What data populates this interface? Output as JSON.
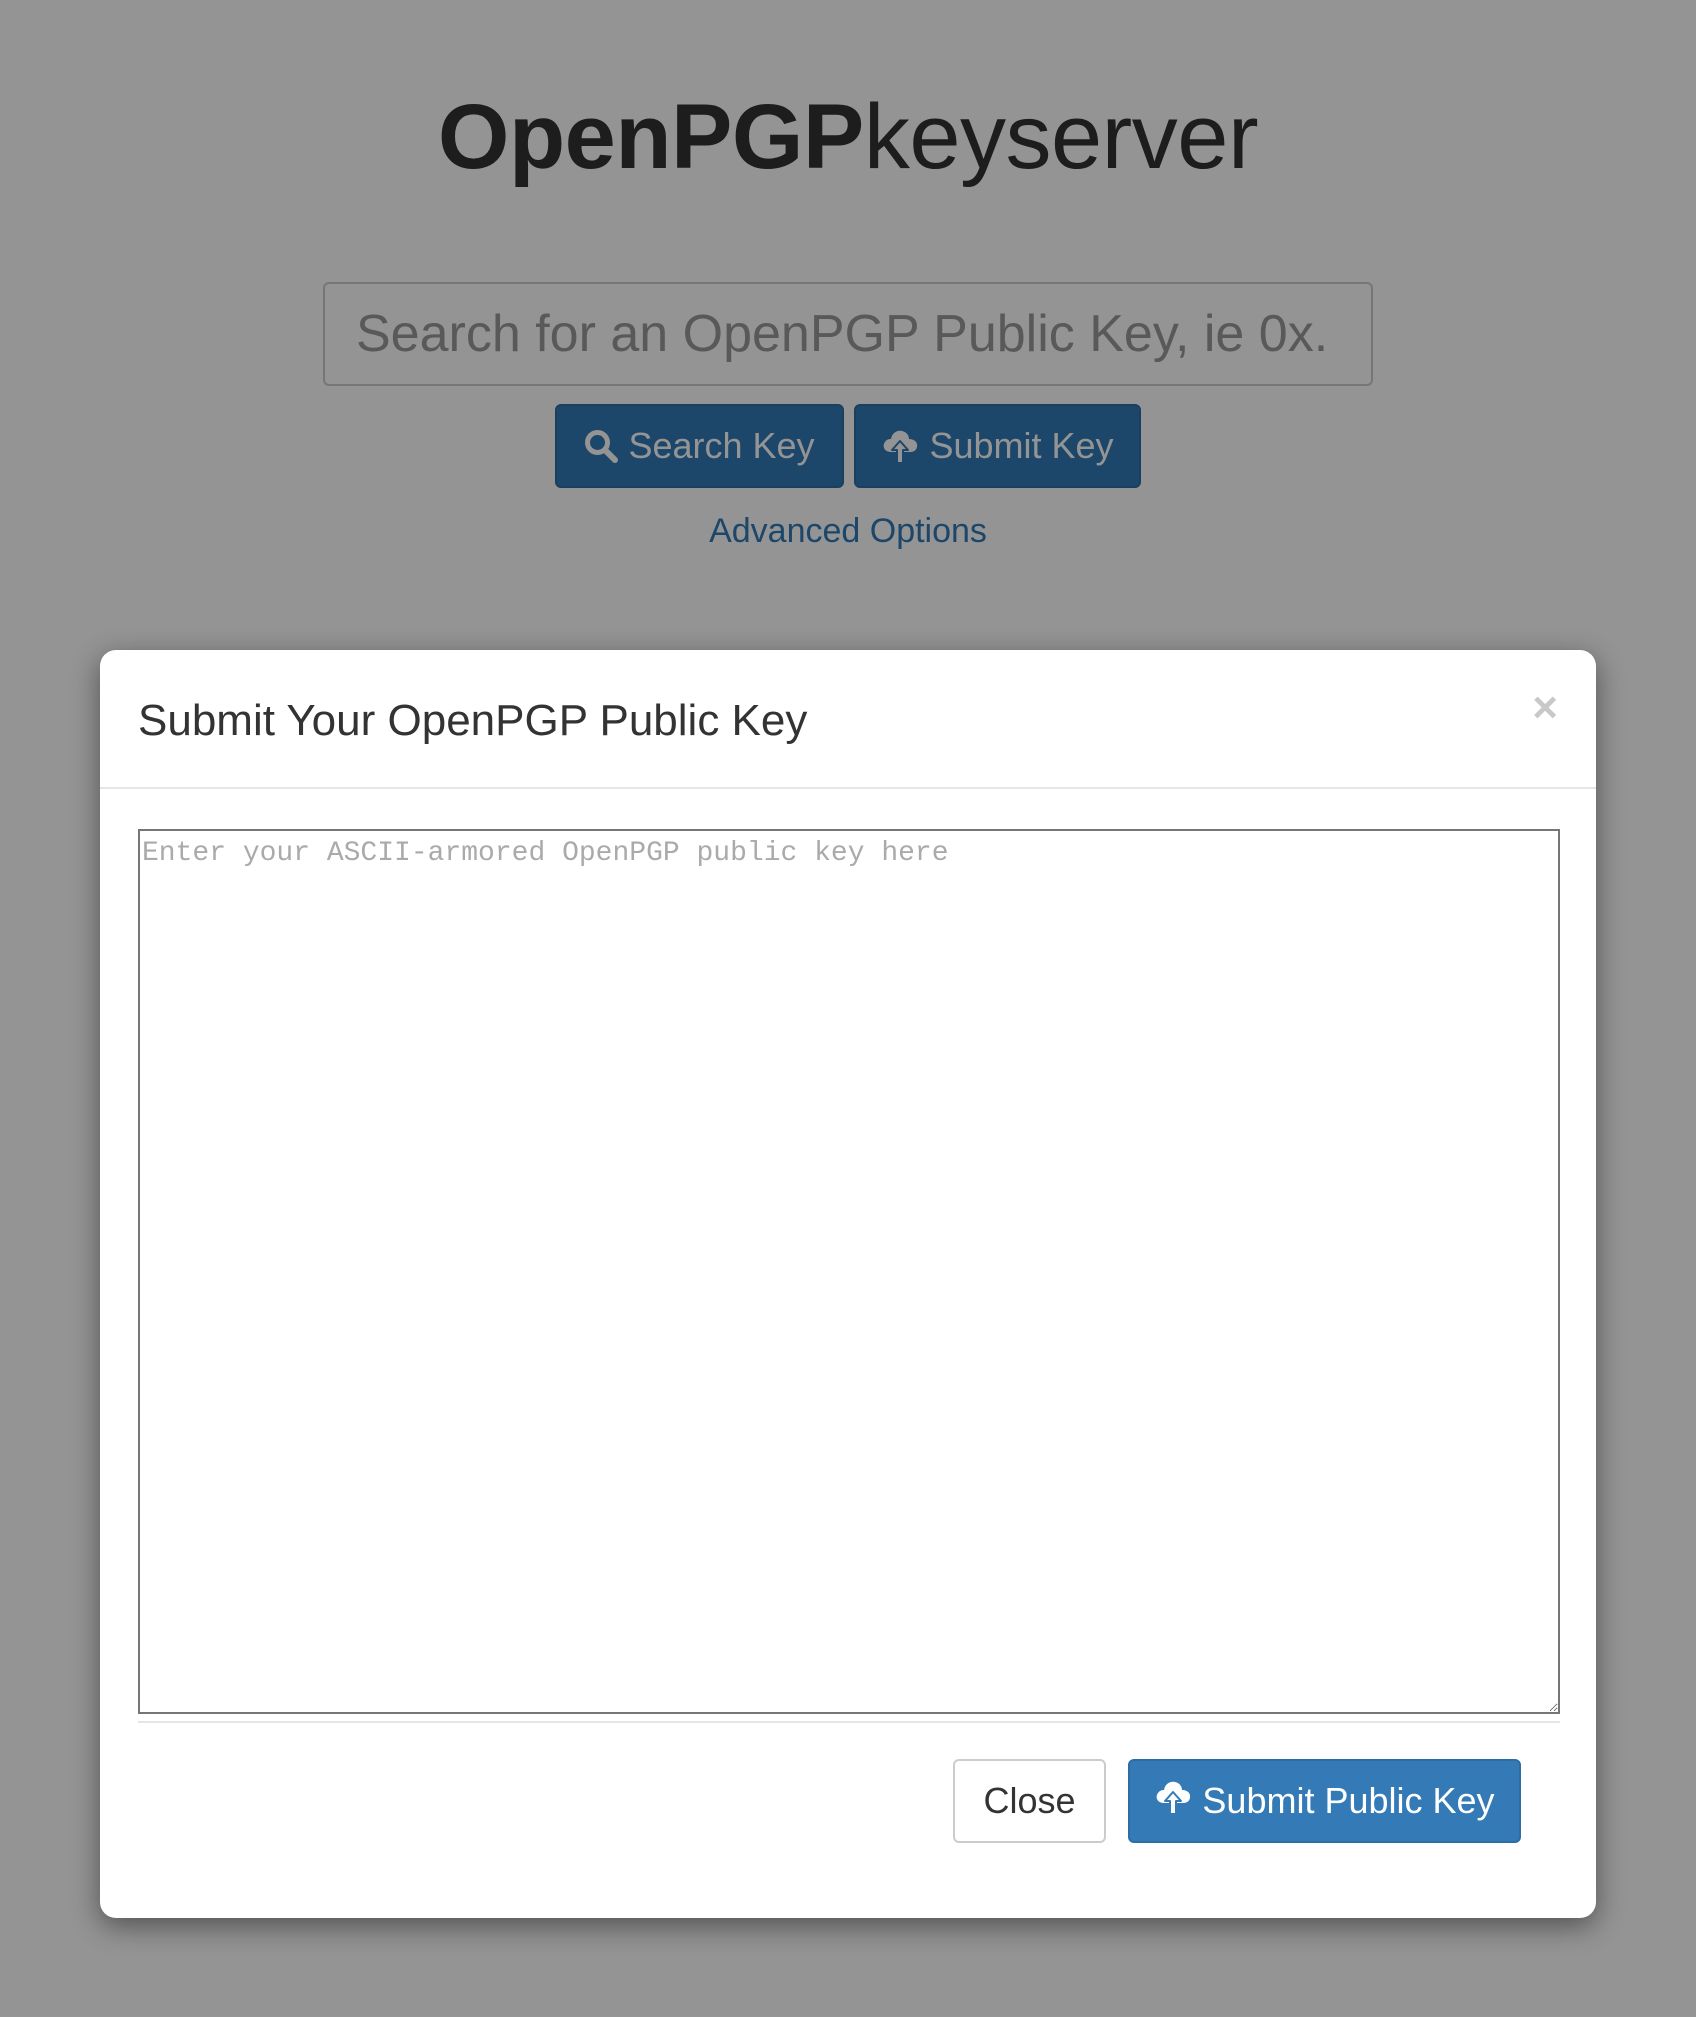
{
  "header": {
    "brand_bold": "OpenPGP",
    "brand_regular": "keyserver"
  },
  "search": {
    "placeholder": "Search for an OpenPGP Public Key, ie 0x.",
    "search_button_label": "Search Key",
    "submit_button_label": "Submit Key",
    "advanced_link": "Advanced Options"
  },
  "modal": {
    "title": "Submit Your OpenPGP Public Key",
    "close_glyph": "×",
    "textarea_placeholder": "Enter your ASCII-armored OpenPGP public key here",
    "close_button_label": "Close",
    "submit_button_label": "Submit Public Key"
  },
  "icons": {
    "search": "search-icon",
    "upload": "cloud-upload-icon"
  },
  "colors": {
    "primary": "#337ab7",
    "link": "#337ab7",
    "backdrop": "rgba(0,0,0,0.42)"
  }
}
